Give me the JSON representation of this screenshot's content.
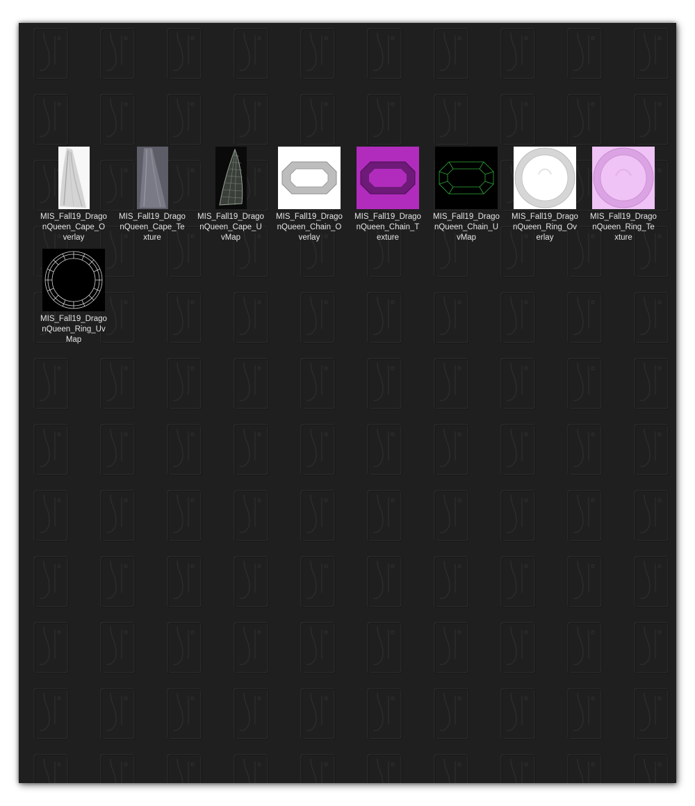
{
  "explorer": {
    "files": [
      {
        "name": "MIS_Fall19_DragonQueen_Cape_Overlay",
        "line1": "MIS_Fall19_Drago",
        "line2": "nQueen_Cape_O",
        "line3": "verlay",
        "thumb": "cape-overlay"
      },
      {
        "name": "MIS_Fall19_DragonQueen_Cape_Texture",
        "line1": "MIS_Fall19_Drago",
        "line2": "nQueen_Cape_Te",
        "line3": "xture",
        "thumb": "cape-texture"
      },
      {
        "name": "MIS_Fall19_DragonQueen_Cape_UvMap",
        "line1": "MIS_Fall19_Drago",
        "line2": "nQueen_Cape_U",
        "line3": "vMap",
        "thumb": "cape-uvmap"
      },
      {
        "name": "MIS_Fall19_DragonQueen_Chain_Overlay",
        "line1": "MIS_Fall19_Drago",
        "line2": "nQueen_Chain_O",
        "line3": "verlay",
        "thumb": "chain-overlay"
      },
      {
        "name": "MIS_Fall19_DragonQueen_Chain_Texture",
        "line1": "MIS_Fall19_Drago",
        "line2": "nQueen_Chain_T",
        "line3": "exture",
        "thumb": "chain-texture"
      },
      {
        "name": "MIS_Fall19_DragonQueen_Chain_UvMap",
        "line1": "MIS_Fall19_Drago",
        "line2": "nQueen_Chain_U",
        "line3": "vMap",
        "thumb": "chain-uvmap"
      },
      {
        "name": "MIS_Fall19_DragonQueen_Ring_Overlay",
        "line1": "MIS_Fall19_Drago",
        "line2": "nQueen_Ring_Ov",
        "line3": "erlay",
        "thumb": "ring-overlay"
      },
      {
        "name": "MIS_Fall19_DragonQueen_Ring_Texture",
        "line1": "MIS_Fall19_Drago",
        "line2": "nQueen_Ring_Te",
        "line3": "xture",
        "thumb": "ring-texture"
      },
      {
        "name": "MIS_Fall19_DragonQueen_Ring_UvMap",
        "line1": "MIS_Fall19_Drago",
        "line2": "nQueen_Ring_Uv",
        "line3": "Map",
        "thumb": "ring-uvmap"
      }
    ]
  },
  "colors": {
    "background": "#1f1f1f",
    "label_text": "#e6e6e6",
    "magenta": "#b12cbd",
    "light_pink": "#efc3f5",
    "uv_green": "#2fae3a"
  }
}
